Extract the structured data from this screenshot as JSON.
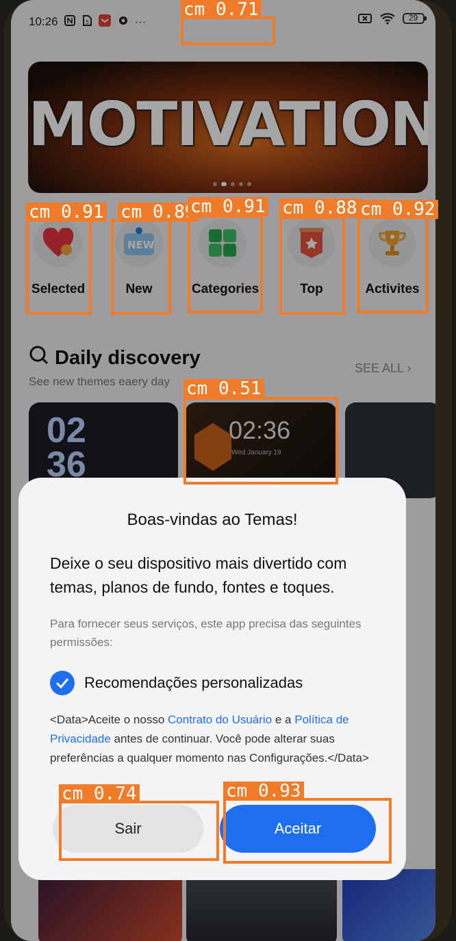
{
  "status_bar": {
    "time": "10:26",
    "battery": "29"
  },
  "banner": {
    "title": "MOTIVATION"
  },
  "categories": [
    {
      "label": "Selected",
      "icon": "heart-icon"
    },
    {
      "label": "New",
      "icon": "new-badge-icon"
    },
    {
      "label": "Categories",
      "icon": "grid-icon"
    },
    {
      "label": "Top",
      "icon": "ribbon-star-icon"
    },
    {
      "label": "Activites",
      "icon": "trophy-icon"
    }
  ],
  "daily_discovery": {
    "title": "Daily discovery",
    "subtitle": "See new themes eaery day",
    "see_all": "SEE ALL",
    "thumb1_time": "02\n36",
    "thumb2_time": "02:36",
    "thumb2_date": "Wed    January 19"
  },
  "dialog": {
    "title": "Boas-vindas ao Temas!",
    "body": "Deixe o seu dispositivo mais divertido com temas, planos de fundo, fontes e toques.",
    "permissions_text": "Para fornecer seus serviços, este app precisa das seguintes permissões:",
    "checkbox_label": "Recomendações personalizadas",
    "legal_prefix": "<Data>Aceite o nosso ",
    "legal_link1": "Contrato do Usuário",
    "legal_mid": " e a ",
    "legal_link2": "Política de Privacidade",
    "legal_suffix": " antes de continuar. Você pode alterar suas preferências a qualquer momento nas Configurações.</Data>",
    "exit_label": "Sair",
    "accept_label": "Aceitar"
  },
  "detections": [
    {
      "label": "cm 0.71"
    },
    {
      "label": "cm 0.91"
    },
    {
      "label": "cm 0.89"
    },
    {
      "label": "cm 0.91"
    },
    {
      "label": "cm 0.88"
    },
    {
      "label": "cm 0.92"
    },
    {
      "label": "cm 0.51"
    },
    {
      "label": "cm 0.74"
    },
    {
      "label": "cm 0.93"
    }
  ],
  "colors": {
    "accent": "#1d6ff0",
    "detection": "#f07c2a"
  }
}
